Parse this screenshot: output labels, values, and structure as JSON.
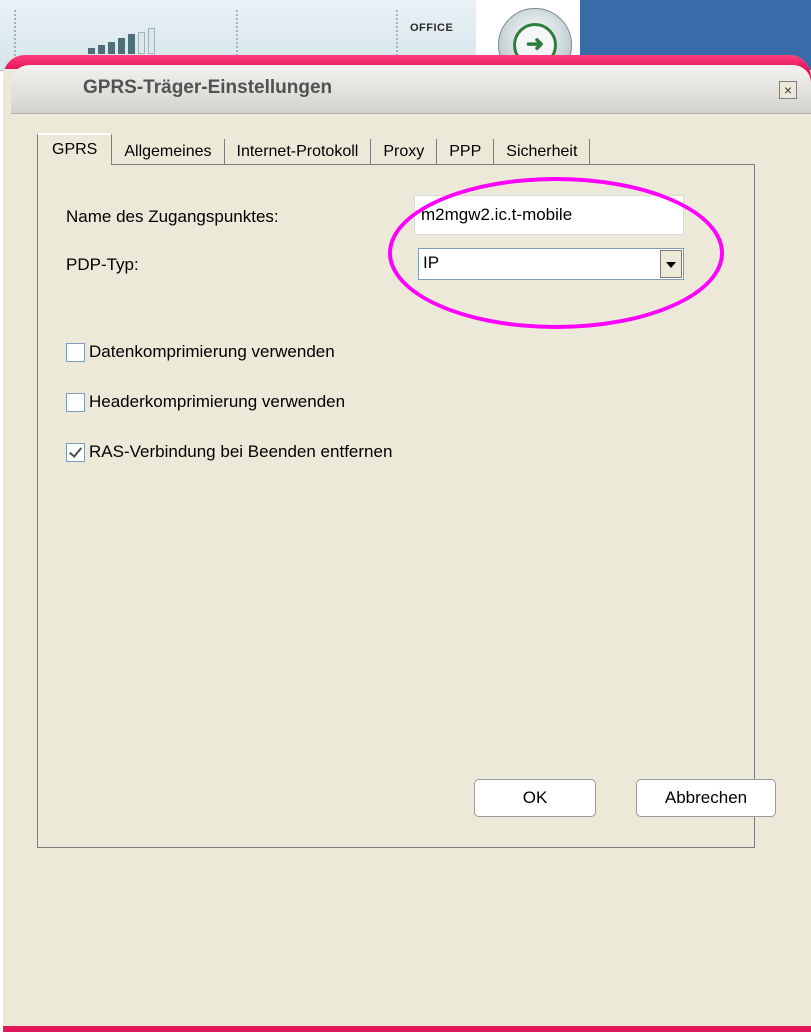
{
  "background_app": {
    "office_label": "OFFICE"
  },
  "dialog": {
    "title": "GPRS-Träger-Einstellungen",
    "close_symbol": "×",
    "tabs": [
      {
        "label": "GPRS",
        "active": true
      },
      {
        "label": "Allgemeines",
        "active": false
      },
      {
        "label": "Internet-Protokoll",
        "active": false
      },
      {
        "label": "Proxy",
        "active": false
      },
      {
        "label": "PPP",
        "active": false
      },
      {
        "label": "Sicherheit",
        "active": false
      }
    ],
    "fields": {
      "apn_label": "Name des Zugangspunktes:",
      "apn_value": "m2mgw2.ic.t-mobile",
      "pdp_label": "PDP-Typ:",
      "pdp_value": "IP"
    },
    "checkboxes": [
      {
        "label": "Datenkomprimierung verwenden",
        "checked": false
      },
      {
        "label": "Headerkomprimierung verwenden",
        "checked": false
      },
      {
        "label": "RAS-Verbindung bei Beenden entfernen",
        "checked": true
      }
    ],
    "buttons": {
      "ok": "OK",
      "cancel": "Abbrechen"
    }
  },
  "colors": {
    "accent_frame": "#e0185a",
    "highlight_ellipse": "#ff00ff",
    "dialog_face": "#ece9d8",
    "header_blue": "#3a6aa8"
  }
}
